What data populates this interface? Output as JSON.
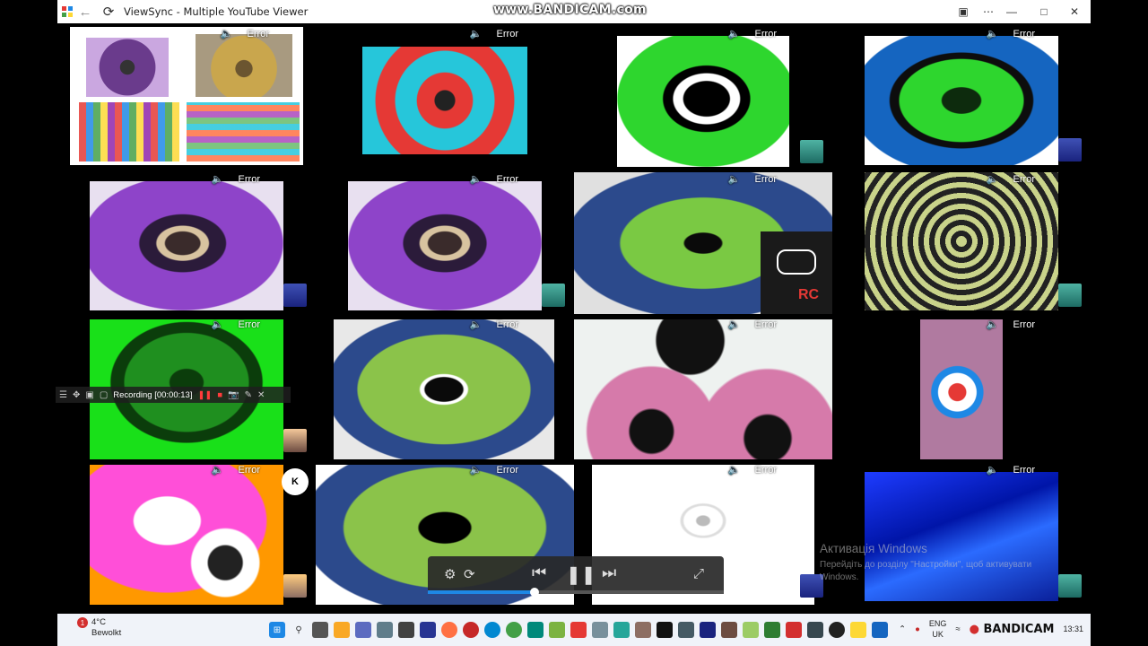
{
  "window": {
    "title": "ViewSync - Multiple YouTube Viewer",
    "watermark": "www.BANDICAM.com"
  },
  "tiles": [
    {
      "status": "Error"
    },
    {
      "status": "Error"
    },
    {
      "status": "Error"
    },
    {
      "status": "Error"
    },
    {
      "status": "Error"
    },
    {
      "status": "Error"
    },
    {
      "status": "Error"
    },
    {
      "status": "Error"
    },
    {
      "status": "Error"
    },
    {
      "status": "Error"
    },
    {
      "status": "Error"
    },
    {
      "status": "Error"
    },
    {
      "status": "Error"
    },
    {
      "status": "Error"
    },
    {
      "status": "Error"
    },
    {
      "status": "Error"
    }
  ],
  "recording": {
    "label": "Recording [00:00:13]"
  },
  "player": {
    "progress": 0.36
  },
  "activation": {
    "title": "Активація Windows",
    "line1": "Перейдіть до розділу \"Настройки\", щоб активувати",
    "line2": "Windows."
  },
  "taskbar": {
    "temperature": "4°C",
    "weather": "Bewolkt",
    "notification_count": "1",
    "lang_top": "ENG",
    "lang_bottom": "UK",
    "time": "13:31",
    "tray_brand": "BANDICAM"
  },
  "colors": {
    "titlebar_bg": "#ffffff",
    "taskbar_bg": "#f0f3f9",
    "progress": "#1e88e5",
    "record_red": "#ff3b3b"
  }
}
